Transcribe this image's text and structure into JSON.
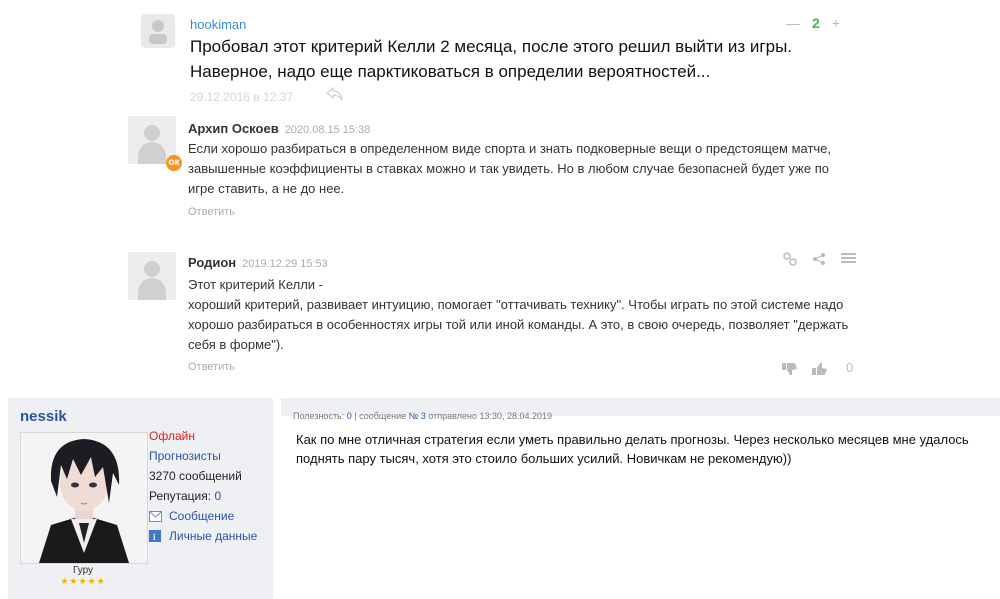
{
  "comment1": {
    "author": "hookiman",
    "vote_minus": "—",
    "vote_score": "2",
    "vote_plus": "+",
    "text": "Пробовал этот критерий Келли 2 месяца, после этого решил выйти из игры. Наверное, надо еще парктиковаться в определии вероятностей...",
    "date": "29.12.2016 в 12:37",
    "reply_icon": "reply-icon"
  },
  "comment2": {
    "author": "Архип Оскоев",
    "date": "2020.08.15 15:38",
    "badge": "ok",
    "text": "Если хорошо разбираться в определенном виде спорта и знать подковерные вещи о предстоящем матче, завышенные коэффициенты в  ставках можно и так увидеть. Но в любом случае безопасней будет уже по игре ставить, а не до нее.",
    "reply": "Ответить"
  },
  "comment3": {
    "author": "Родион",
    "date": "2019.12.29 15:53",
    "line1": "Этот критерий Келли -",
    "text": "хороший критерий,  развивает интуицию, помогает \"оттачивать технику\". Чтобы играть по этой системе надо хорошо разбираться в особенностях игры той или иной команды. А это, в свою очередь, позволяет \"держать себя в форме\").",
    "reply": "Ответить",
    "likes": "0"
  },
  "forum_post": {
    "nick": "nessik",
    "status": "Офлайн",
    "group": "Прогнозисты",
    "messages": "3270 сообщений",
    "reputation_label": "Репутация: ",
    "reputation_value": "0",
    "message_link": "Сообщение",
    "personal_link": "Личные данные",
    "rank": "Гуру",
    "stars": "★★★★★",
    "meta_prefix": "Полезность: ",
    "meta_useful": "0",
    "meta_mid": " | сообщение ",
    "meta_num": "№ 3",
    "meta_suffix": " отправлено 13:30, 28.04.2019",
    "text": "Как по мне отличная стратегия если уметь правильно делать прогнозы. Через несколько месяцев мне удалось поднять пару тысяч, хотя это стоило больших усилий. Новичкам не рекомендую))"
  }
}
